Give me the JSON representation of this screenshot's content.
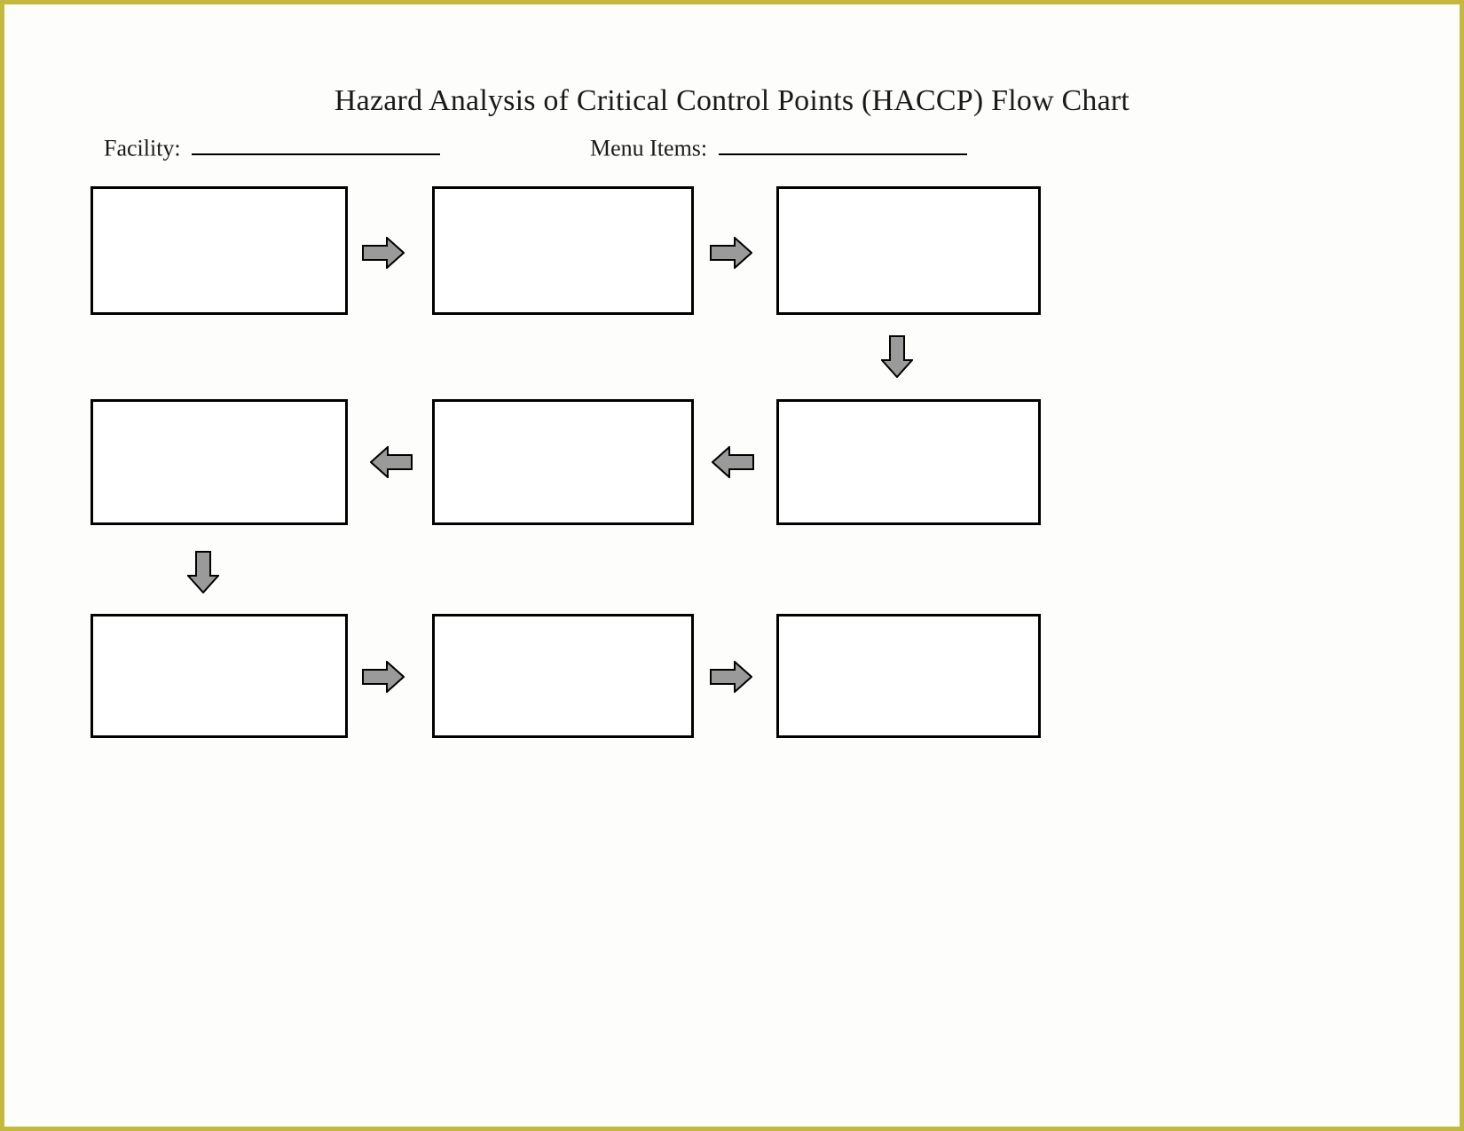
{
  "title": "Hazard Analysis of Critical Control Points (HACCP) Flow Chart",
  "fields": {
    "facility_label": "Facility:",
    "facility_value": "",
    "menu_items_label": "Menu Items:",
    "menu_items_value": ""
  },
  "flow": {
    "boxes": [
      "",
      "",
      "",
      "",
      "",
      "",
      "",
      "",
      ""
    ],
    "arrows": [
      {
        "dir": "right"
      },
      {
        "dir": "right"
      },
      {
        "dir": "down"
      },
      {
        "dir": "left"
      },
      {
        "dir": "left"
      },
      {
        "dir": "down"
      },
      {
        "dir": "right"
      },
      {
        "dir": "right"
      }
    ]
  },
  "colors": {
    "page_border": "#c4b93e",
    "arrow_fill": "#9a9a9a"
  }
}
